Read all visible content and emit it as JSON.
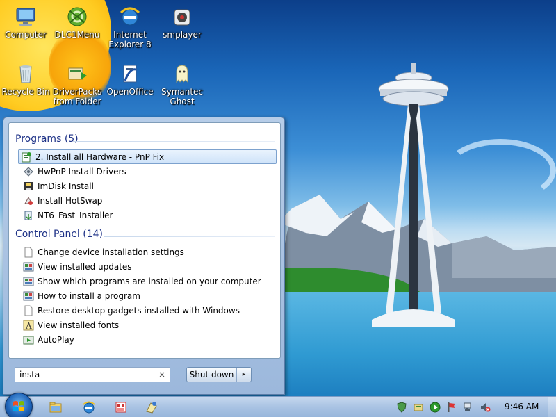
{
  "desktop": {
    "icons": [
      {
        "label": "Computer",
        "icon": "computer-icon"
      },
      {
        "label": "DLC1Menu",
        "icon": "dlc1menu-icon"
      },
      {
        "label": "Internet Explorer 8",
        "icon": "internet-explorer-icon"
      },
      {
        "label": "smplayer",
        "icon": "smplayer-icon"
      },
      {
        "label": "Recycle Bin",
        "icon": "recycle-bin-icon"
      },
      {
        "label": "DriverPacks from Folder",
        "icon": "driverpacks-icon"
      },
      {
        "label": "OpenOffice",
        "icon": "openoffice-icon"
      },
      {
        "label": "Symantec Ghost",
        "icon": "ghost-icon"
      }
    ]
  },
  "start_menu": {
    "programs": {
      "title": "Programs (5)",
      "items": [
        {
          "label": "2. Install all Hardware - PnP Fix",
          "icon": "installer-icon",
          "selected": true
        },
        {
          "label": "HwPnP Install Drivers",
          "icon": "drivers-icon"
        },
        {
          "label": "ImDisk Install",
          "icon": "imdisk-icon"
        },
        {
          "label": "Install HotSwap",
          "icon": "hotswap-icon"
        },
        {
          "label": "NT6_Fast_Installer",
          "icon": "nt6-installer-icon"
        }
      ]
    },
    "control_panel": {
      "title": "Control Panel (14)",
      "items": [
        {
          "label": "Change device installation settings",
          "icon": "document-icon"
        },
        {
          "label": "View installed updates",
          "icon": "control-panel-icon"
        },
        {
          "label": "Show which programs are installed on your computer",
          "icon": "control-panel-icon"
        },
        {
          "label": "How to install a program",
          "icon": "control-panel-icon"
        },
        {
          "label": "Restore desktop gadgets installed with Windows",
          "icon": "document-icon"
        },
        {
          "label": "View installed fonts",
          "icon": "fonts-icon"
        },
        {
          "label": "AutoPlay",
          "icon": "autoplay-icon"
        }
      ]
    },
    "search": {
      "value": "insta",
      "clear_glyph": "×"
    },
    "shutdown": {
      "label": "Shut down",
      "arrow": "▸"
    }
  },
  "taskbar": {
    "pinned": [
      "explorer-icon",
      "internet-explorer-icon",
      "media-icon",
      "paint-icon"
    ],
    "tray": [
      "security-icon",
      "drivers-tray-icon",
      "media-player-tray-icon",
      "flag-icon",
      "network-icon",
      "volume-muted-icon"
    ],
    "clock": "9:46 AM"
  },
  "colors": {
    "group_title": "#1e3287",
    "selection_border": "#7da2ce",
    "taskbar": "#a9c3e3"
  }
}
